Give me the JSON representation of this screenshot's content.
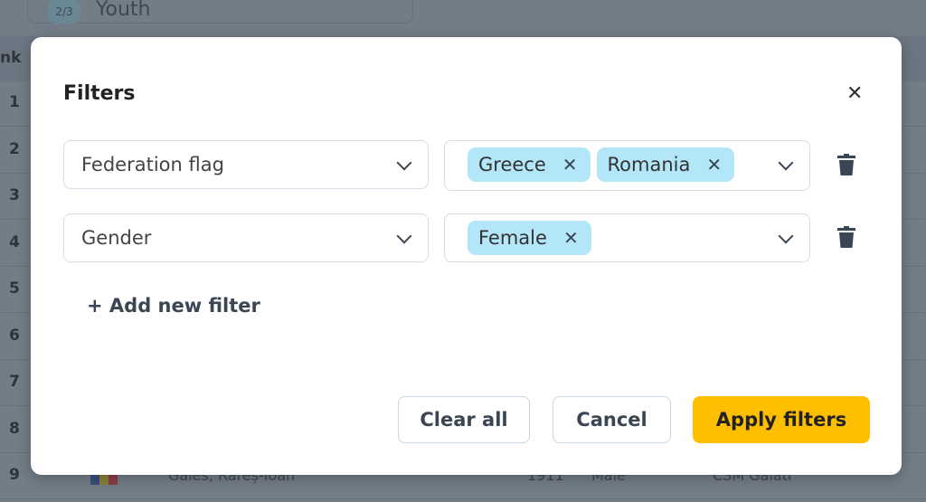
{
  "background": {
    "group_badge": "2/3",
    "group_select": "Youth",
    "rank_header": "nk",
    "rows": [
      {
        "rank": "1"
      },
      {
        "rank": "2"
      },
      {
        "rank": "3"
      },
      {
        "rank": "4"
      },
      {
        "rank": "5"
      },
      {
        "rank": "6"
      },
      {
        "rank": "7"
      },
      {
        "rank": "8"
      },
      {
        "rank": "9",
        "name": "Gales, Rareș-Ioan",
        "year": "1911",
        "gender": "Male",
        "club": "CSM Galati"
      }
    ]
  },
  "modal": {
    "title": "Filters",
    "close_icon": "close-icon",
    "filters": [
      {
        "field": "Federation flag",
        "values": [
          "Greece",
          "Romania"
        ]
      },
      {
        "field": "Gender",
        "values": [
          "Female"
        ]
      }
    ],
    "add_label": "+ Add new filter",
    "clear_label": "Clear all",
    "cancel_label": "Cancel",
    "apply_label": "Apply filters",
    "accent_color": "#fdbf00",
    "tag_color": "#b3e6f8"
  }
}
